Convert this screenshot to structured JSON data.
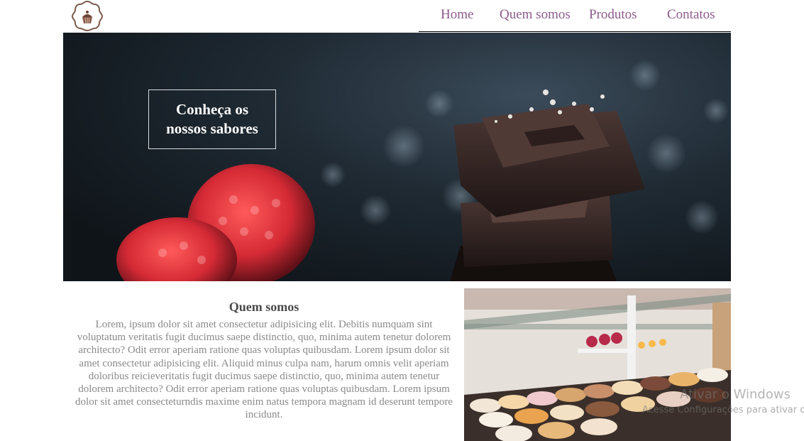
{
  "nav": {
    "home": "Home",
    "about": "Quem somos",
    "products": "Produtos",
    "contacts": "Contatos"
  },
  "hero": {
    "line1": "Conheça os",
    "line2": "nossos sabores"
  },
  "about": {
    "title": "Quem somos",
    "text": "Lorem, ipsum dolor sit amet consectetur adipisicing elit. Debitis numquam sint voluptatum veritatis fugit ducimus saepe distinctio, quo, minima autem tenetur dolorem architecto? Odit error aperiam ratione quas voluptas quibusdam. Lorem ipsum dolor sit amet consectetur adipisicing elit. Aliquid minus culpa nam, harum omnis velit aperiam doloribus reicieveritatis fugit ducimus saepe distinctio, quo, minima autem tenetur dolorem architecto? Odit error aperiam ratione quas voluptas quibusdam. Lorem ipsum dolor sit amet consecteturndis maxime enim natus tempora magnam id deserunt tempore incidunt."
  },
  "watermark": {
    "title": "Ativar o Windows",
    "subtitle": "Acesse Configurações para ativar o Windows."
  },
  "colors": {
    "nav": "#8e5b8c",
    "text_gray": "#8a8a8a",
    "title_gray": "#4a4a4a"
  },
  "icons": {
    "logo": "cupcake-logo-icon"
  }
}
